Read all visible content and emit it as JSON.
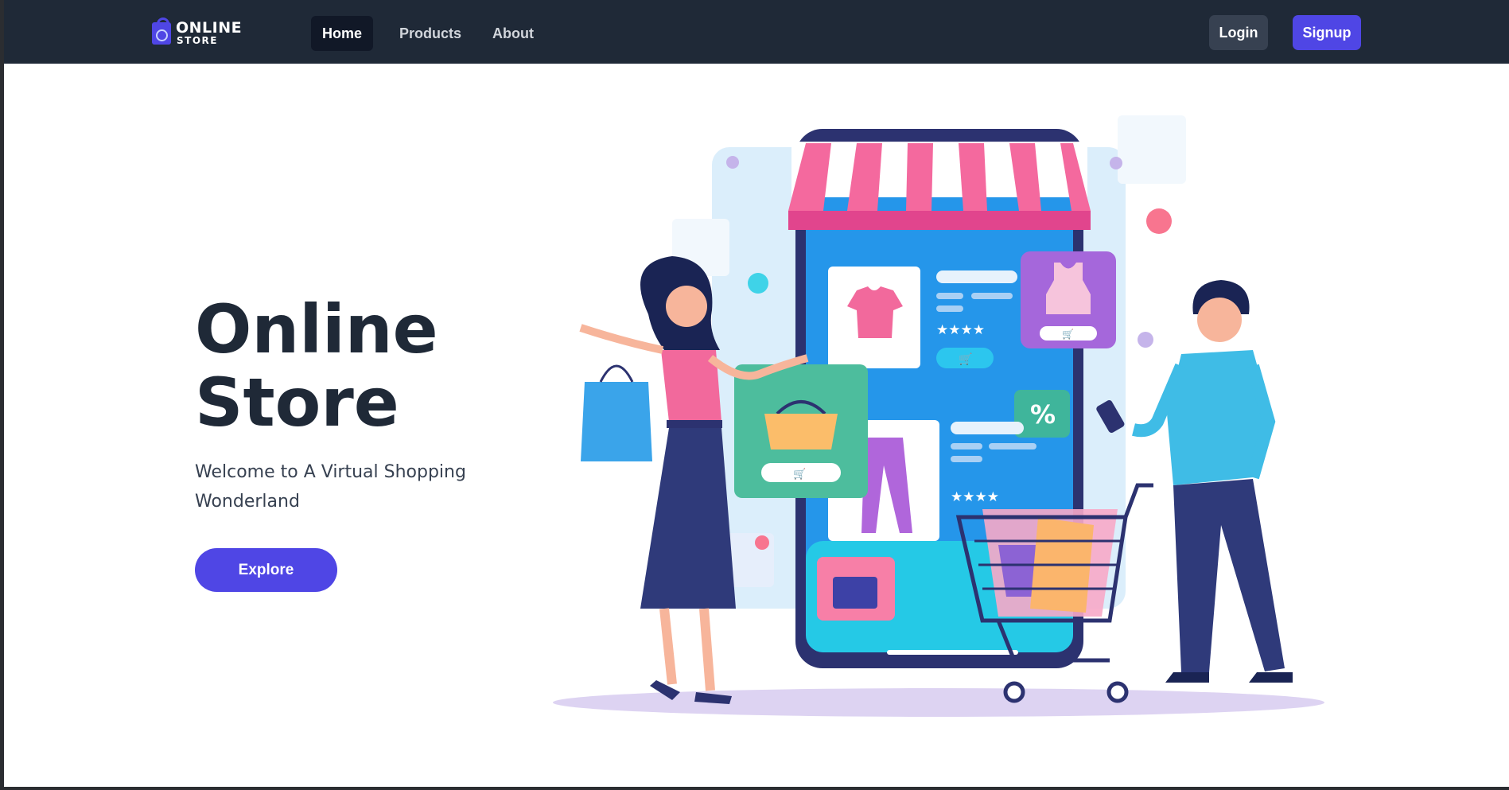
{
  "logo": {
    "line1": "ONLINE",
    "line2": "STORE",
    "icon": "shopping-bag-icon"
  },
  "nav": {
    "links": [
      {
        "label": "Home",
        "active": true
      },
      {
        "label": "Products",
        "active": false
      },
      {
        "label": "About",
        "active": false
      }
    ],
    "login_label": "Login",
    "signup_label": "Signup"
  },
  "hero": {
    "title_line1": "Online",
    "title_line2": "Store",
    "subtitle": "Welcome to A Virtual Shopping Wonderland",
    "explore_label": "Explore"
  },
  "colors": {
    "nav_bg": "#1f2937",
    "accent": "#4f46e5",
    "heading": "#1f2937",
    "text": "#374151",
    "login_bg": "#374151",
    "active_link_bg": "#111827"
  },
  "illustration": {
    "subject": "shopping-illustration",
    "badge_text": "%"
  }
}
